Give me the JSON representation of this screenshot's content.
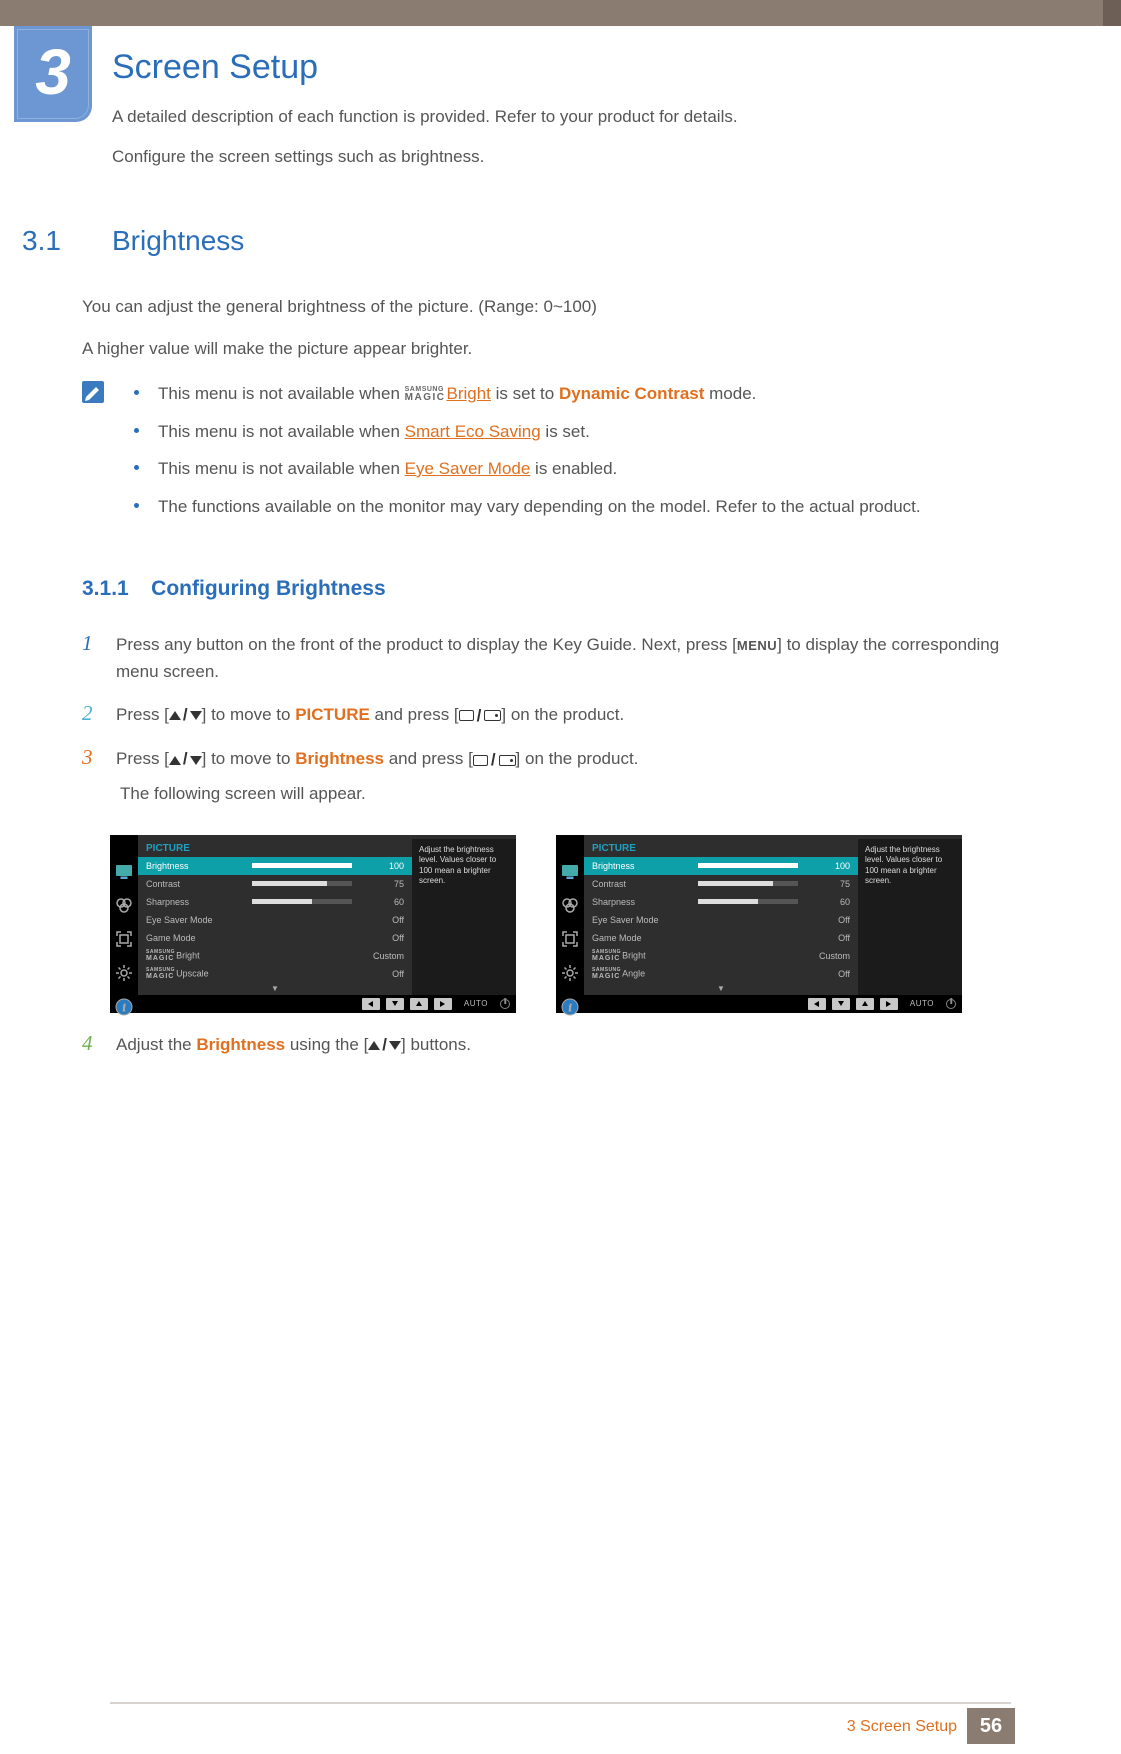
{
  "chapter": {
    "number": "3",
    "title": "Screen Setup"
  },
  "intro": {
    "p1": "A detailed description of each function is provided. Refer to your product for details.",
    "p2": "Configure the screen settings such as brightness."
  },
  "section": {
    "number": "3.1",
    "title": "Brightness",
    "p1": "You can adjust the general brightness of the picture. (Range: 0~100)",
    "p2": "A higher value will make the picture appear brighter."
  },
  "notes": {
    "magic_logo_top": "SAMSUNG",
    "magic_logo_bot": "MAGIC",
    "n1_a": "This menu is not available when ",
    "n1_link": "Bright",
    "n1_b": " is set to ",
    "n1_mode": "Dynamic Contrast",
    "n1_c": " mode.",
    "n2_a": "This menu is not available when ",
    "n2_link": "Smart Eco Saving",
    "n2_b": " is set.",
    "n3_a": "This menu is not available when ",
    "n3_link": "Eye Saver Mode",
    "n3_b": " is enabled.",
    "n4": "The functions available on the monitor may vary depending on the model. Refer to the actual product."
  },
  "subsection": {
    "number": "3.1.1",
    "title": "Configuring Brightness"
  },
  "steps": {
    "s1_a": "Press any button on the front of the product to display the Key Guide. Next, press [",
    "s1_menu": "MENU",
    "s1_b": "] to display the corresponding menu screen.",
    "s2_a": "Press [",
    "s2_b": "] to move to ",
    "s2_picture": "PICTURE",
    "s2_c": " and press [",
    "s2_d": "] on the product.",
    "s3_a": "Press [",
    "s3_b": "] to move to ",
    "s3_brightness": "Brightness",
    "s3_c": " and press [",
    "s3_d": "] on the product.",
    "s3_follow": "The following screen will appear.",
    "s4_a": "Adjust the ",
    "s4_brightness": "Brightness",
    "s4_b": " using the [",
    "s4_c": "] buttons."
  },
  "osd": {
    "title": "PICTURE",
    "help": "Adjust the brightness level. Values closer to 100 mean a brighter screen.",
    "auto": "AUTO",
    "items": [
      {
        "label": "Brightness",
        "value": "100",
        "bar": 100,
        "selected": true,
        "hasBar": true
      },
      {
        "label": "Contrast",
        "value": "75",
        "bar": 75,
        "selected": false,
        "hasBar": true
      },
      {
        "label": "Sharpness",
        "value": "60",
        "bar": 60,
        "selected": false,
        "hasBar": true
      },
      {
        "label": "Eye Saver Mode",
        "value": "Off",
        "selected": false,
        "hasBar": false
      },
      {
        "label": "Game Mode",
        "value": "Off",
        "selected": false,
        "hasBar": false
      },
      {
        "label": "Bright",
        "value": "Custom",
        "selected": false,
        "hasBar": false,
        "magic": true
      },
      {
        "label": "Upscale",
        "value": "Off",
        "selected": false,
        "hasBar": false,
        "magic": true
      }
    ],
    "items2_last": {
      "label": "Angle",
      "value": "Off",
      "magic": true
    }
  },
  "footer": {
    "chapter_ref": "3 Screen Setup",
    "page": "56"
  }
}
